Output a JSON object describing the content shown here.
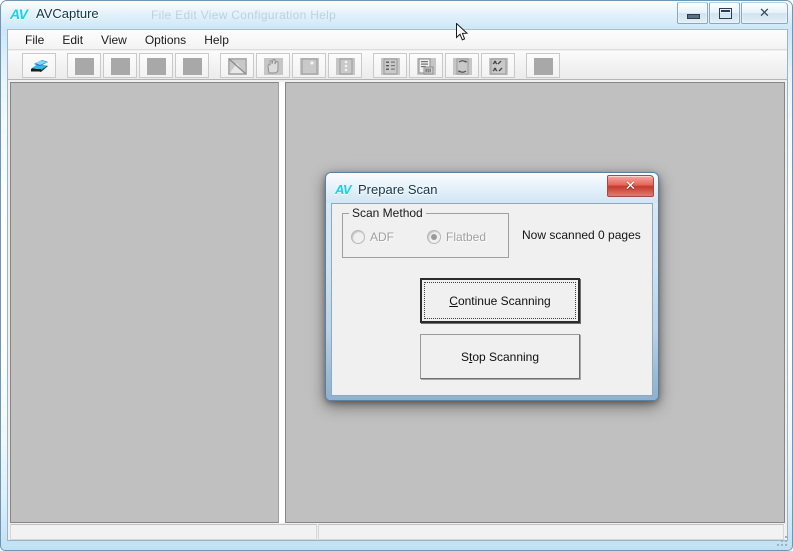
{
  "window": {
    "logo": "AV",
    "title": "AVCapture",
    "ghost_text": "File   Edit   View   Configuration   Help",
    "controls": {
      "minimize": "minimize-button",
      "maximize": "maximize-button",
      "close": "close-button",
      "close_glyph": "✕"
    }
  },
  "menubar": {
    "items": [
      {
        "label": "File"
      },
      {
        "label": "Edit"
      },
      {
        "label": "View"
      },
      {
        "label": "Options"
      },
      {
        "label": "Help"
      }
    ]
  },
  "toolbar": {
    "buttons": [
      {
        "name": "scan-button",
        "icon": "scanner-icon",
        "state": "enabled"
      },
      {
        "name": "toolbar-button-2",
        "icon": "blank-square-icon",
        "state": "disabled"
      },
      {
        "name": "toolbar-button-3",
        "icon": "blank-square-icon",
        "state": "disabled"
      },
      {
        "name": "toolbar-button-4",
        "icon": "blank-square-icon",
        "state": "disabled"
      },
      {
        "name": "toolbar-button-5",
        "icon": "blank-square-icon",
        "state": "disabled"
      },
      {
        "name": "toolbar-button-6",
        "icon": "image-select-icon",
        "state": "disabled"
      },
      {
        "name": "toolbar-button-7",
        "icon": "hand-pan-icon",
        "state": "disabled"
      },
      {
        "name": "toolbar-button-8",
        "icon": "page-icon",
        "state": "disabled"
      },
      {
        "name": "toolbar-button-9",
        "icon": "page-dots-icon",
        "state": "disabled"
      },
      {
        "name": "toolbar-button-10",
        "icon": "list-icon",
        "state": "disabled"
      },
      {
        "name": "toolbar-button-11",
        "icon": "document-lines-icon",
        "state": "disabled"
      },
      {
        "name": "toolbar-button-12",
        "icon": "rotate-icon",
        "state": "disabled"
      },
      {
        "name": "toolbar-button-13",
        "icon": "scatter-icon",
        "state": "disabled"
      },
      {
        "name": "toolbar-button-14",
        "icon": "blank-square-icon",
        "state": "disabled"
      }
    ]
  },
  "panels": {
    "left": {
      "name": "thumbnail-panel",
      "content": ""
    },
    "right": {
      "name": "preview-panel",
      "content": ""
    }
  },
  "statusbar": {
    "pane1": "",
    "pane2": ""
  },
  "dialog": {
    "logo": "AV",
    "title": "Prepare Scan",
    "close_glyph": "✕",
    "scan_method": {
      "legend": "Scan Method",
      "options": [
        {
          "label": "ADF",
          "selected": false,
          "enabled": false
        },
        {
          "label": "Flatbed",
          "selected": true,
          "enabled": false
        }
      ]
    },
    "status": {
      "prefix": "Now scanned",
      "count": "0",
      "suffix": "pages",
      "full": "Now scanned  0  pages"
    },
    "buttons": [
      {
        "name": "continue-scanning-button",
        "accel": "C",
        "rest": "ontinue Scanning",
        "focused": true
      },
      {
        "name": "stop-scanning-button",
        "pre": "S",
        "accel": "t",
        "rest": "op Scanning",
        "focused": false
      }
    ]
  },
  "colors": {
    "accent_cyan": "#17d3e8",
    "close_red": "#c43a2e",
    "panel_gray": "#c0c0c0",
    "dialog_face": "#f0f0f0",
    "frame_blue": "#5c7f9e"
  }
}
